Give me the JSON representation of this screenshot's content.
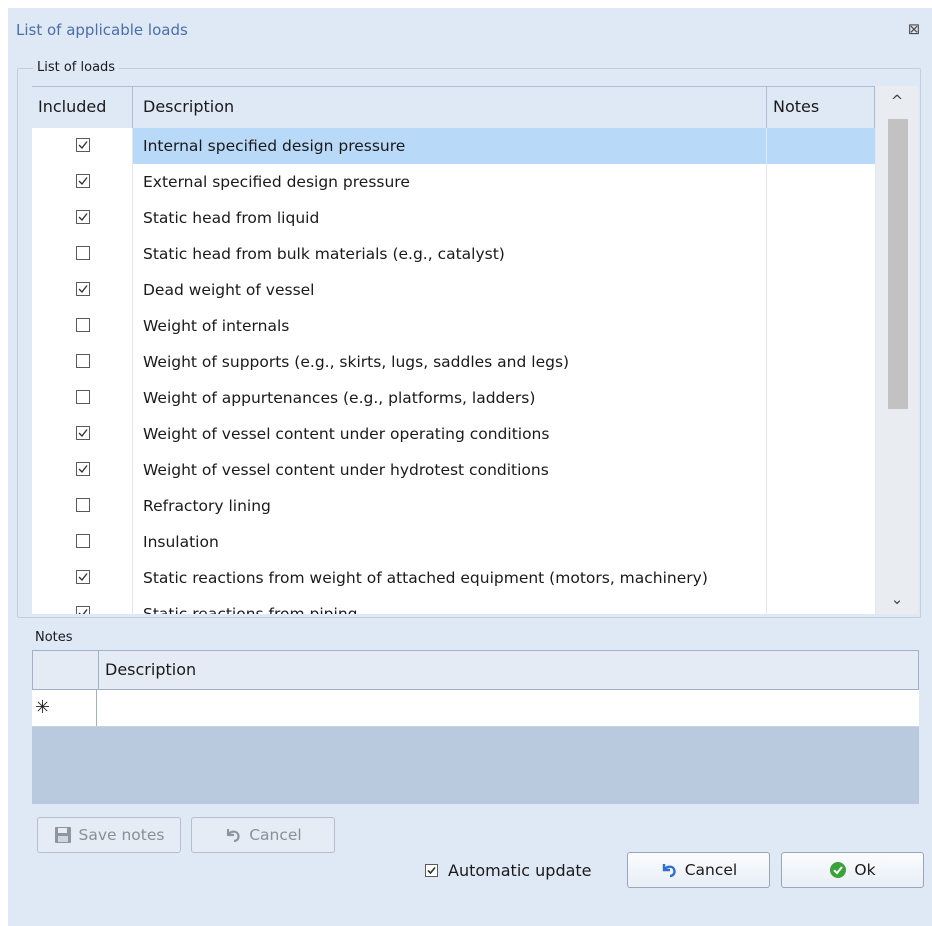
{
  "window": {
    "title": "List of applicable loads",
    "close_glyph": "⊠"
  },
  "loads_group": {
    "legend": "List of loads",
    "columns": {
      "included": "Included",
      "description": "Description",
      "notes": "Notes"
    },
    "rows": [
      {
        "description": "Internal specified design pressure",
        "included": true,
        "selected": true
      },
      {
        "description": "External specified design pressure",
        "included": true
      },
      {
        "description": "Static head from liquid",
        "included": true
      },
      {
        "description": "Static head from bulk materials (e.g., catalyst)",
        "included": false
      },
      {
        "description": "Dead weight of vessel",
        "included": true
      },
      {
        "description": "Weight of internals",
        "included": false
      },
      {
        "description": "Weight of supports (e.g., skirts, lugs, saddles and legs)",
        "included": false
      },
      {
        "description": "Weight of appurtenances (e.g., platforms, ladders)",
        "included": false
      },
      {
        "description": "Weight of vessel content under operating conditions",
        "included": true
      },
      {
        "description": "Weight of vessel content under hydrotest conditions",
        "included": true
      },
      {
        "description": "Refractory lining",
        "included": false
      },
      {
        "description": "Insulation",
        "included": false
      },
      {
        "description": "Static reactions from weight of attached equipment (motors, machinery)",
        "included": true
      },
      {
        "description": "Static reactions from piping",
        "included": true
      }
    ],
    "scroll_up_glyph": "^",
    "scroll_down_glyph": "⌄"
  },
  "notes": {
    "label": "Notes",
    "column_description": "Description",
    "new_row_glyph": "✳"
  },
  "buttons": {
    "save_notes": "Save notes",
    "cancel_notes": "Cancel",
    "cancel": "Cancel",
    "ok": "Ok"
  },
  "automatic_update": {
    "label": "Automatic update",
    "checked": true
  },
  "colors": {
    "selected_row": "#b9d9f8",
    "dialog_bg": "#dfe8f5",
    "title": "#4a6fa8",
    "ok_icon": "#3aa23a",
    "undo_icon": "#2f6fd0"
  },
  "icons": {
    "save_notes": "floppy-disk-icon",
    "cancel_notes": "undo-icon",
    "cancel": "undo-icon",
    "ok": "check-circle-icon"
  }
}
